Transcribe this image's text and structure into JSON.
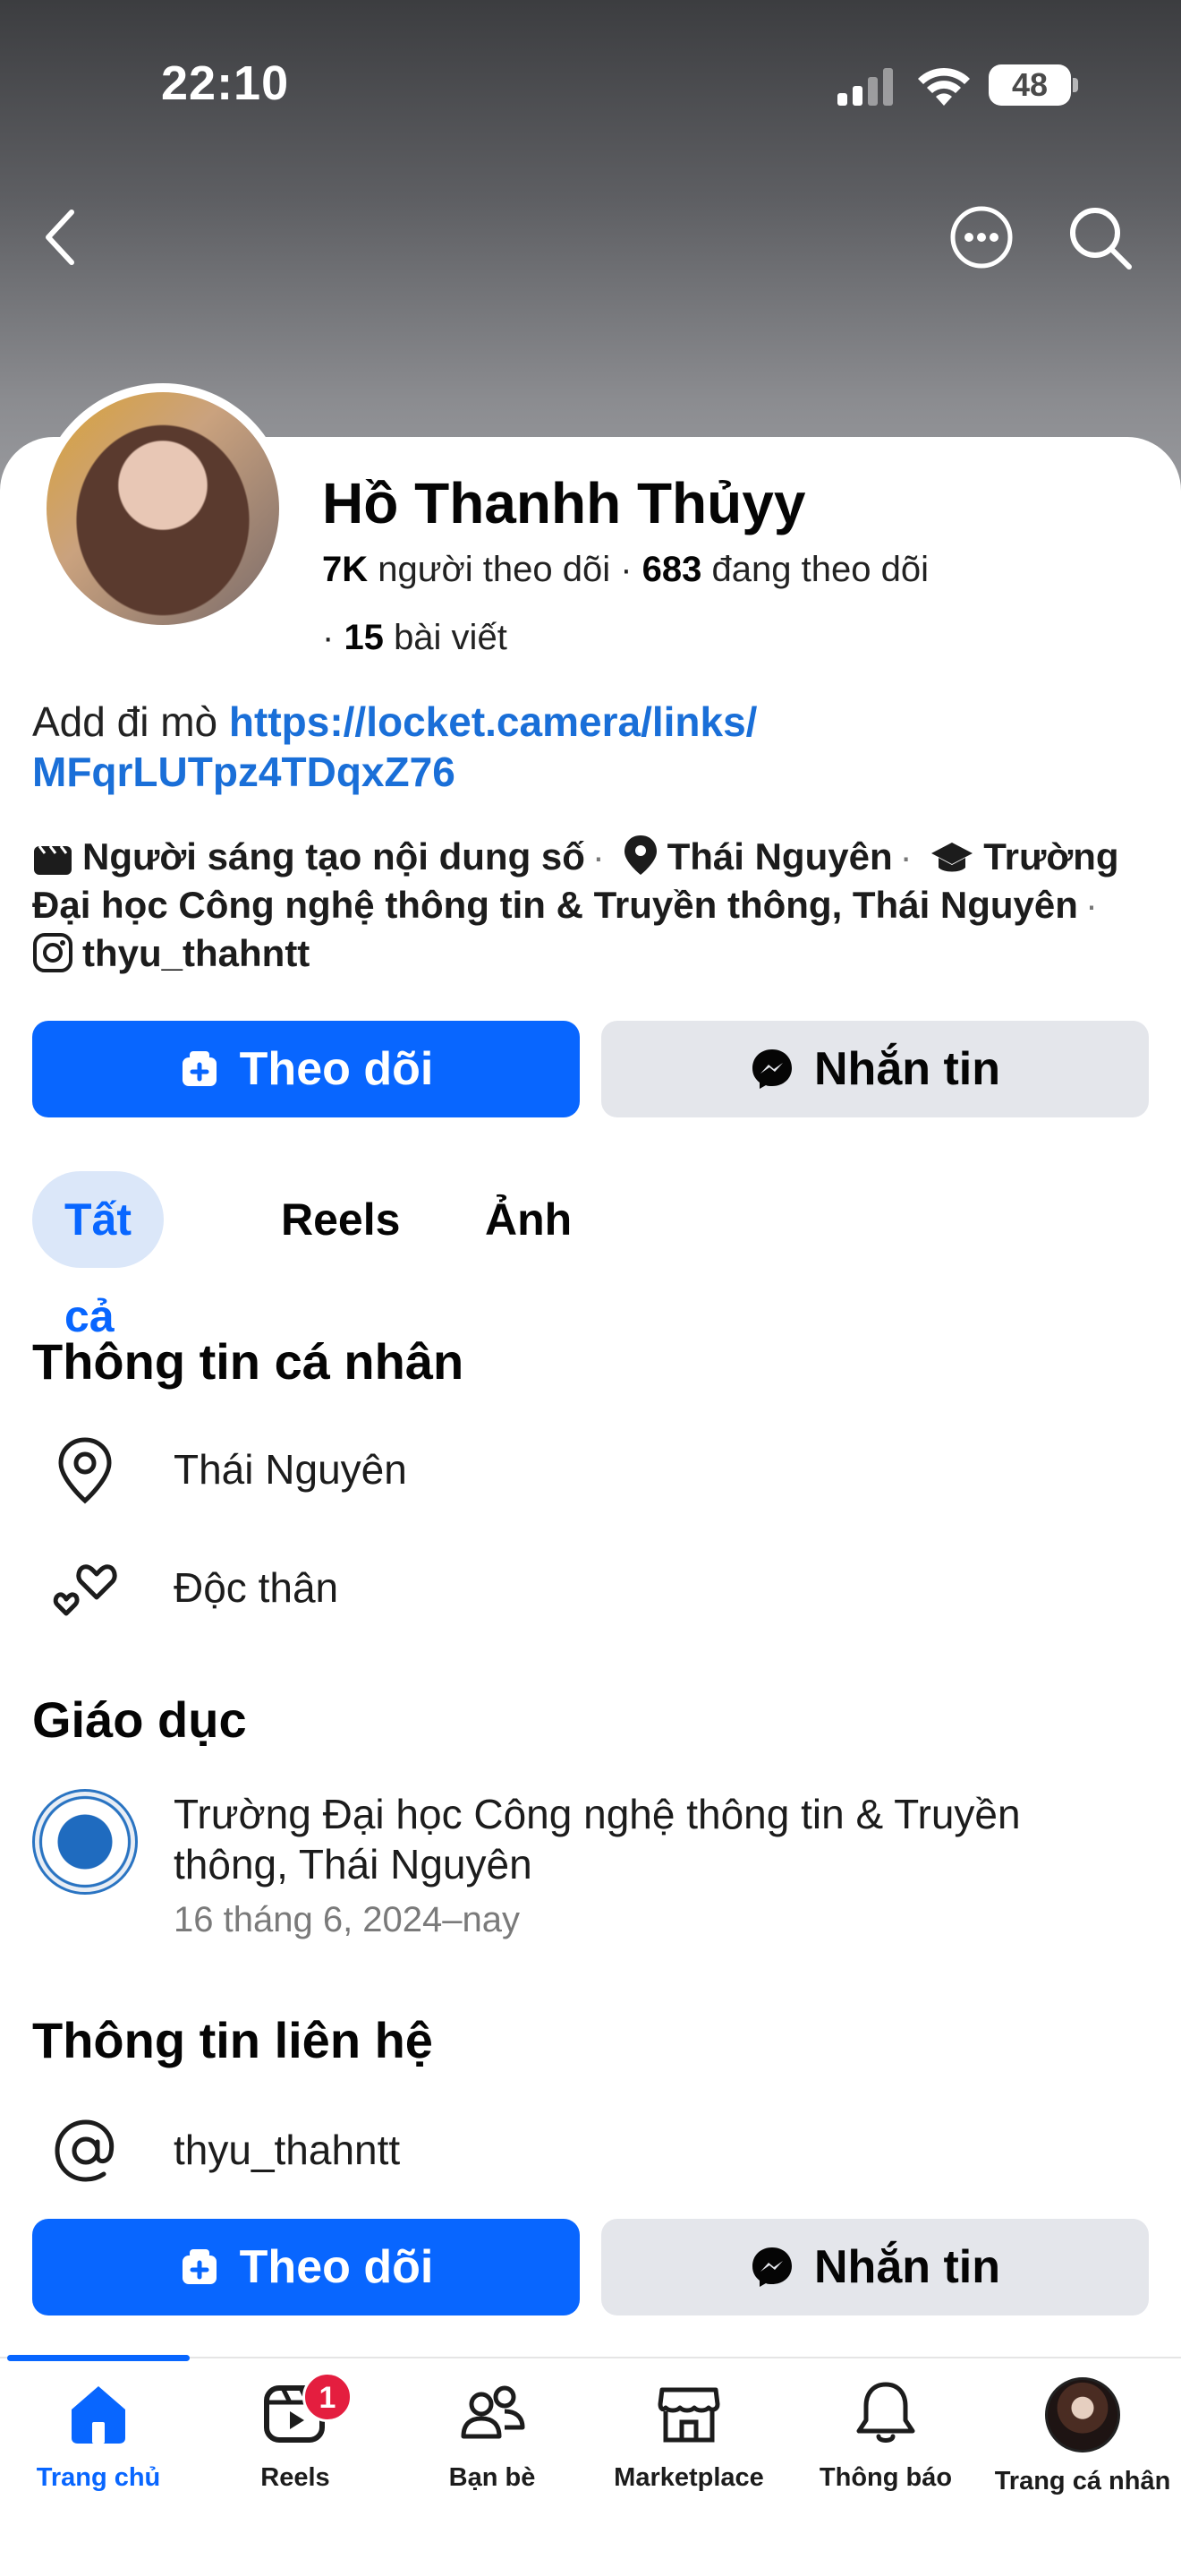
{
  "status_bar": {
    "time": "22:10",
    "battery": "48"
  },
  "profile": {
    "name": "Hồ Thanhh Thủyy",
    "followers_count": "7K",
    "followers_label": "người theo dõi",
    "following_count": "683",
    "following_label": "đang theo dõi",
    "posts_count": "15",
    "posts_label": "bài viết",
    "bio_text": "Add đi mò",
    "bio_link_line1": "https://locket.camera/links/",
    "bio_link_line2": "MFqrLUTpz4TDqxZ76"
  },
  "meta": {
    "creator": "Người sáng tạo nội dung số",
    "location": "Thái Nguyên",
    "school_line1": "Trường",
    "school_line2": "Đại học Công nghệ thông tin & Truyền thông, Thái Nguyên",
    "instagram": "thyu_thahntt"
  },
  "buttons": {
    "follow": "Theo dõi",
    "message": "Nhắn tin"
  },
  "tabs": [
    {
      "label": "Tất cả",
      "active": true
    },
    {
      "label": "Reels",
      "active": false
    },
    {
      "label": "Ảnh",
      "active": false
    }
  ],
  "personal_info": {
    "title": "Thông tin cá nhân",
    "location": "Thái Nguyên",
    "relationship": "Độc thân"
  },
  "education": {
    "title": "Giáo dục",
    "school_line1": "Trường Đại học Công nghệ thông tin & Truyền",
    "school_line2": "thông, Thái Nguyên",
    "dates": "16 tháng 6, 2024–nay"
  },
  "contact": {
    "title": "Thông tin liên hệ",
    "instagram": "thyu_thahntt"
  },
  "bottom_nav": {
    "items": [
      {
        "label": "Trang chủ",
        "icon": "home-icon",
        "active": true
      },
      {
        "label": "Reels",
        "icon": "reels-icon",
        "badge": "1"
      },
      {
        "label": "Bạn bè",
        "icon": "friends-icon"
      },
      {
        "label": "Marketplace",
        "icon": "marketplace-icon"
      },
      {
        "label": "Thông báo",
        "icon": "bell-icon"
      },
      {
        "label": "Trang cá nhân",
        "icon": "profile-avatar"
      }
    ]
  },
  "colors": {
    "accent": "#0866ff",
    "link": "#1a6fd8",
    "button_secondary": "#e4e6eb",
    "badge": "#e41e3f"
  }
}
